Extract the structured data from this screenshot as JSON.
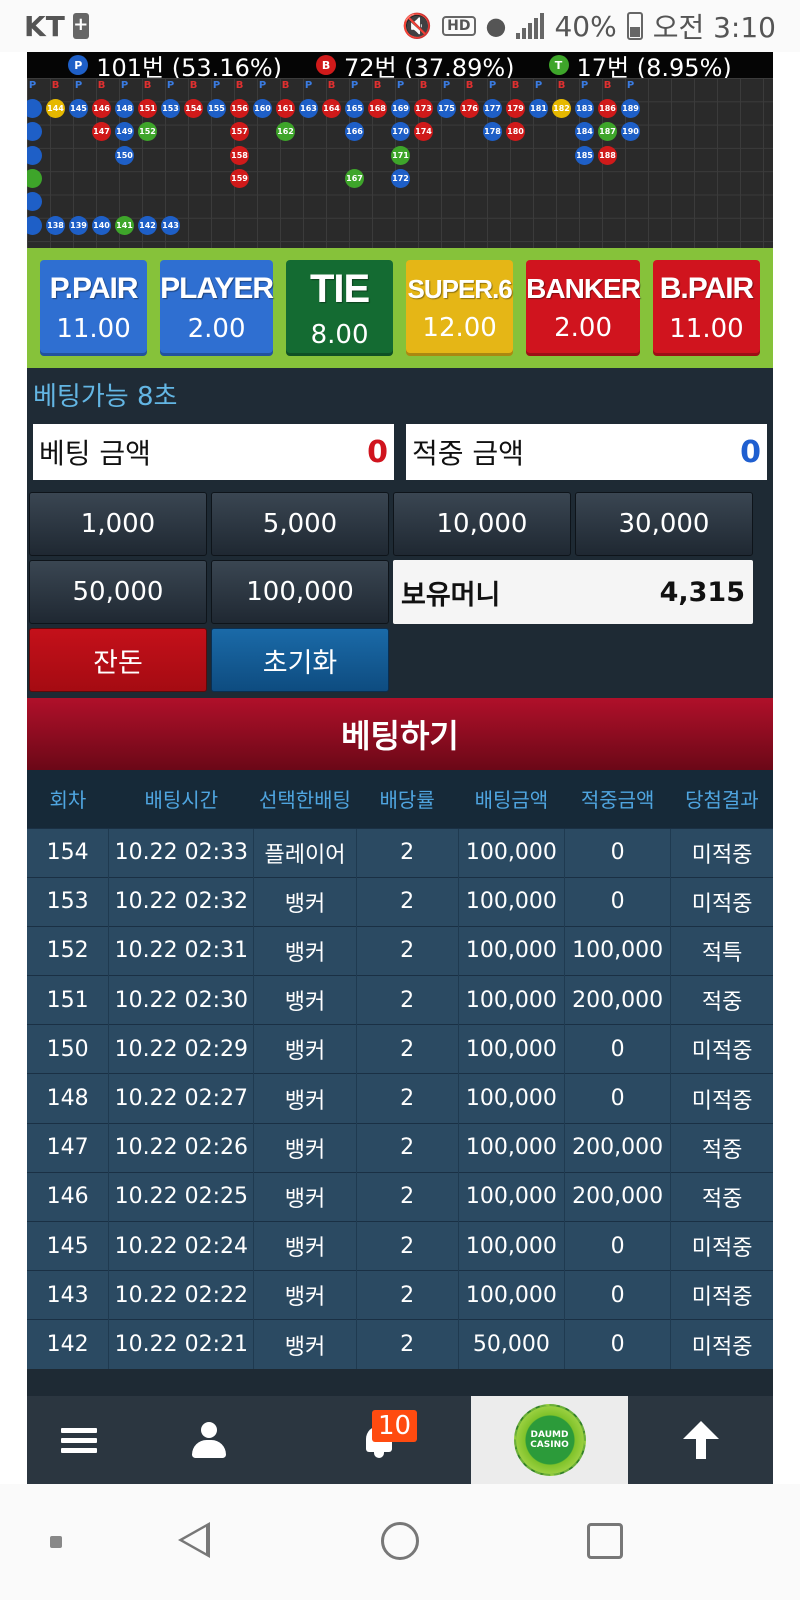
{
  "status_bar": {
    "carrier": "KT",
    "hd": "HD",
    "battery": "40%",
    "time": "오전 3:10"
  },
  "stats": [
    {
      "type": "P",
      "text": "101번 (53.16%)",
      "color": "#1e5fc7"
    },
    {
      "type": "B",
      "text": "72번 (37.89%)",
      "color": "#d01a1a"
    },
    {
      "type": "T",
      "text": "17번 (8.95%)",
      "color": "#3ea52a"
    }
  ],
  "road": {
    "headers": [
      "P",
      "B",
      "P",
      "B",
      "P",
      "B",
      "P",
      "B",
      "P",
      "B",
      "P",
      "B",
      "P",
      "B",
      "P",
      "B",
      "P",
      "B",
      "P",
      "B",
      "P",
      "B",
      "P",
      "B",
      "P",
      "B",
      "P"
    ],
    "columns": [
      [
        {
          "n": "",
          "t": "P"
        },
        {
          "n": "",
          "t": "P"
        },
        {
          "n": "",
          "t": "P"
        },
        {
          "n": "",
          "t": "T"
        },
        {
          "n": "",
          "t": "P"
        },
        {
          "n": "",
          "t": "P"
        }
      ],
      [
        {
          "n": "144",
          "t": "Y"
        },
        {
          "n": "",
          "t": ""
        },
        {
          "n": "",
          "t": ""
        },
        {
          "n": "",
          "t": ""
        },
        {
          "n": "",
          "t": ""
        },
        {
          "n": "138",
          "t": "P"
        }
      ],
      [
        {
          "n": "145",
          "t": "P"
        },
        {
          "n": "",
          "t": ""
        },
        {
          "n": "",
          "t": ""
        },
        {
          "n": "",
          "t": ""
        },
        {
          "n": "",
          "t": ""
        },
        {
          "n": "139",
          "t": "P"
        }
      ],
      [
        {
          "n": "146",
          "t": "B"
        },
        {
          "n": "147",
          "t": "B"
        },
        {
          "n": "",
          "t": ""
        },
        {
          "n": "",
          "t": ""
        },
        {
          "n": "",
          "t": ""
        },
        {
          "n": "140",
          "t": "P"
        }
      ],
      [
        {
          "n": "148",
          "t": "P"
        },
        {
          "n": "149",
          "t": "P"
        },
        {
          "n": "150",
          "t": "P"
        },
        {
          "n": "",
          "t": ""
        },
        {
          "n": "",
          "t": ""
        },
        {
          "n": "141",
          "t": "T"
        }
      ],
      [
        {
          "n": "151",
          "t": "B"
        },
        {
          "n": "152",
          "t": "T"
        },
        {
          "n": "",
          "t": ""
        },
        {
          "n": "",
          "t": ""
        },
        {
          "n": "",
          "t": ""
        },
        {
          "n": "142",
          "t": "P"
        }
      ],
      [
        {
          "n": "153",
          "t": "P"
        },
        {
          "n": "",
          "t": ""
        },
        {
          "n": "",
          "t": ""
        },
        {
          "n": "",
          "t": ""
        },
        {
          "n": "",
          "t": ""
        },
        {
          "n": "143",
          "t": "P"
        }
      ],
      [
        {
          "n": "154",
          "t": "B"
        }
      ],
      [
        {
          "n": "155",
          "t": "P"
        }
      ],
      [
        {
          "n": "156",
          "t": "B"
        },
        {
          "n": "157",
          "t": "B"
        },
        {
          "n": "158",
          "t": "B"
        },
        {
          "n": "159",
          "t": "B"
        }
      ],
      [
        {
          "n": "160",
          "t": "P"
        }
      ],
      [
        {
          "n": "161",
          "t": "B"
        },
        {
          "n": "162",
          "t": "T"
        }
      ],
      [
        {
          "n": "163",
          "t": "P"
        }
      ],
      [
        {
          "n": "164",
          "t": "B"
        }
      ],
      [
        {
          "n": "165",
          "t": "P"
        },
        {
          "n": "166",
          "t": "P"
        },
        {
          "n": "",
          "t": ""
        },
        {
          "n": "167",
          "t": "T"
        }
      ],
      [
        {
          "n": "168",
          "t": "B"
        }
      ],
      [
        {
          "n": "169",
          "t": "P"
        },
        {
          "n": "170",
          "t": "P"
        },
        {
          "n": "171",
          "t": "T"
        },
        {
          "n": "172",
          "t": "P"
        }
      ],
      [
        {
          "n": "173",
          "t": "B"
        },
        {
          "n": "174",
          "t": "B"
        }
      ],
      [
        {
          "n": "175",
          "t": "P"
        }
      ],
      [
        {
          "n": "176",
          "t": "B"
        }
      ],
      [
        {
          "n": "177",
          "t": "P"
        },
        {
          "n": "178",
          "t": "P"
        }
      ],
      [
        {
          "n": "179",
          "t": "B"
        },
        {
          "n": "180",
          "t": "B"
        }
      ],
      [
        {
          "n": "181",
          "t": "P"
        }
      ],
      [
        {
          "n": "182",
          "t": "Y"
        }
      ],
      [
        {
          "n": "183",
          "t": "P"
        },
        {
          "n": "184",
          "t": "P"
        },
        {
          "n": "185",
          "t": "P"
        }
      ],
      [
        {
          "n": "186",
          "t": "B"
        },
        {
          "n": "187",
          "t": "T"
        },
        {
          "n": "188",
          "t": "B"
        }
      ],
      [
        {
          "n": "189",
          "t": "P"
        },
        {
          "n": "190",
          "t": "P"
        }
      ]
    ]
  },
  "bet_options": [
    {
      "name": "P.PAIR",
      "odds": "11.00",
      "color": "blue"
    },
    {
      "name": "PLAYER",
      "odds": "2.00",
      "color": "blue"
    },
    {
      "name": "TIE",
      "odds": "8.00",
      "color": "green"
    },
    {
      "name": "SUPER.6",
      "odds": "12.00",
      "color": "yellow"
    },
    {
      "name": "BANKER",
      "odds": "2.00",
      "color": "red"
    },
    {
      "name": "B.PAIR",
      "odds": "11.00",
      "color": "red"
    }
  ],
  "betting": {
    "timer": "베팅가능 8초",
    "bet_amount_label": "베팅 금액",
    "bet_amount_value": "0",
    "win_amount_label": "적중 금액",
    "win_amount_value": "0"
  },
  "chips": [
    "1,000",
    "5,000",
    "10,000",
    "30,000",
    "50,000",
    "100,000"
  ],
  "money": {
    "label": "보유머니",
    "value": "4,315"
  },
  "buttons": {
    "change": "잔돈",
    "reset": "초기화",
    "bet": "베팅하기"
  },
  "history": {
    "columns": [
      "회차",
      "배팅시간",
      "선택한배팅",
      "배당률",
      "배팅금액",
      "적중금액",
      "당첨결과"
    ],
    "rows": [
      {
        "round": "154",
        "time": "10.22 02:33",
        "choice": "플레이어",
        "odds": "2",
        "bet": "100,000",
        "win": "0",
        "result": "미적중",
        "status": "miss"
      },
      {
        "round": "153",
        "time": "10.22 02:32",
        "choice": "뱅커",
        "odds": "2",
        "bet": "100,000",
        "win": "0",
        "result": "미적중",
        "status": "miss"
      },
      {
        "round": "152",
        "time": "10.22 02:31",
        "choice": "뱅커",
        "odds": "2",
        "bet": "100,000",
        "win": "100,000",
        "result": "적특",
        "status": "special"
      },
      {
        "round": "151",
        "time": "10.22 02:30",
        "choice": "뱅커",
        "odds": "2",
        "bet": "100,000",
        "win": "200,000",
        "result": "적중",
        "status": "hit"
      },
      {
        "round": "150",
        "time": "10.22 02:29",
        "choice": "뱅커",
        "odds": "2",
        "bet": "100,000",
        "win": "0",
        "result": "미적중",
        "status": "miss"
      },
      {
        "round": "148",
        "time": "10.22 02:27",
        "choice": "뱅커",
        "odds": "2",
        "bet": "100,000",
        "win": "0",
        "result": "미적중",
        "status": "miss"
      },
      {
        "round": "147",
        "time": "10.22 02:26",
        "choice": "뱅커",
        "odds": "2",
        "bet": "100,000",
        "win": "200,000",
        "result": "적중",
        "status": "hit"
      },
      {
        "round": "146",
        "time": "10.22 02:25",
        "choice": "뱅커",
        "odds": "2",
        "bet": "100,000",
        "win": "200,000",
        "result": "적중",
        "status": "hit"
      },
      {
        "round": "145",
        "time": "10.22 02:24",
        "choice": "뱅커",
        "odds": "2",
        "bet": "100,000",
        "win": "0",
        "result": "미적중",
        "status": "miss"
      },
      {
        "round": "143",
        "time": "10.22 02:22",
        "choice": "뱅커",
        "odds": "2",
        "bet": "100,000",
        "win": "0",
        "result": "미적중",
        "status": "miss"
      },
      {
        "round": "142",
        "time": "10.22 02:21",
        "choice": "뱅커",
        "odds": "2",
        "bet": "50,000",
        "win": "0",
        "result": "미적중",
        "status": "miss"
      }
    ]
  },
  "bottom_nav": {
    "items": [
      "menu-icon",
      "user-icon",
      "bell-icon",
      "casino-logo",
      "arrow-up-icon"
    ],
    "notification_count": "10",
    "logo_text_1": "DAUMD",
    "logo_text_2": "CASINO"
  },
  "system_nav": {
    "items": [
      "recents-small-icon",
      "back-icon",
      "home-icon",
      "overview-icon"
    ]
  }
}
